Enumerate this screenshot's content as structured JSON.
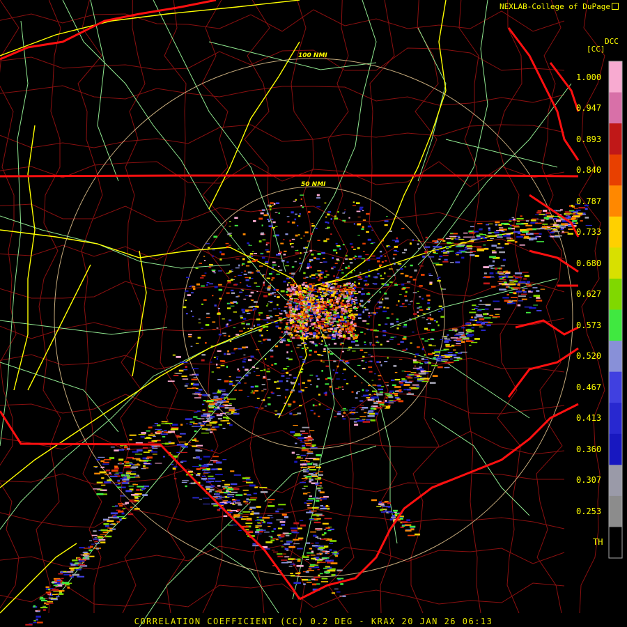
{
  "credit": "NEXLAB-College of DuPage",
  "product_code": "DCC",
  "unit": "[CC]",
  "caption": "CORRELATION COEFFICIENT (CC) 0.2 DEG - KRAX 20 JAN 26 06:13",
  "range_rings": [
    "50 NMI",
    "100 NMI"
  ],
  "colorbar": {
    "labels": [
      "1.000",
      "0.947",
      "0.893",
      "0.840",
      "0.787",
      "0.733",
      "0.680",
      "0.627",
      "0.573",
      "0.520",
      "0.467",
      "0.413",
      "0.360",
      "0.307",
      "0.253",
      "TH"
    ],
    "colors": [
      "#f7aad0",
      "#d870a8",
      "#c01818",
      "#e84000",
      "#ff8800",
      "#ffd000",
      "#d8e000",
      "#80d800",
      "#40e840",
      "#8890d8",
      "#4040e0",
      "#2828d0",
      "#1818c0",
      "#9a9aa8",
      "#8c8c8c",
      "#000000"
    ]
  },
  "colors": {
    "state_border": "#ff1010",
    "county_border": "#8a1010",
    "interstate": "#ffff00",
    "highway": "#90e890",
    "range_ring": "#e8c890",
    "text": "#ffff00"
  }
}
